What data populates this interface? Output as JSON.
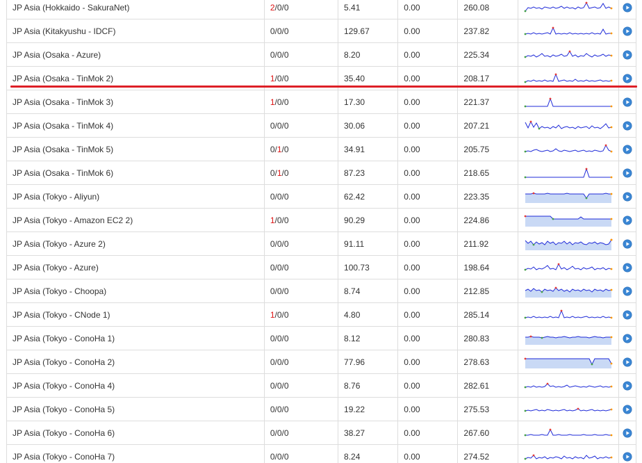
{
  "colors": {
    "loss_highlight": "#dd1111",
    "divider": "#dd1f26",
    "spark_line": "#1f2bd8",
    "spark_fill": "#c9d9f5",
    "play_icon": "#3a86d4"
  },
  "rows": [
    {
      "name": "JP Asia (Hokkaido - SakuraNet)",
      "loss": [
        "2",
        "0",
        "0"
      ],
      "latency": "5.41",
      "jitter": "0.00",
      "max": "260.08",
      "spark": "noisy",
      "sparkline": [
        16,
        11,
        12,
        10,
        12,
        11,
        13,
        10,
        11,
        12,
        10,
        12,
        11,
        9,
        12,
        10,
        12,
        11,
        13,
        10,
        12,
        11,
        4,
        12,
        11,
        10,
        12,
        11,
        5,
        12,
        10,
        12
      ]
    },
    {
      "name": "JP Asia (Kitakyushu - IDCF)",
      "loss": [
        "0",
        "0",
        "0"
      ],
      "latency": "129.67",
      "jitter": "0.00",
      "max": "237.82",
      "spark": "mostly-flat",
      "sparkline": [
        15,
        14,
        15,
        13,
        15,
        14,
        15,
        14,
        13,
        15,
        6,
        15,
        14,
        15,
        14,
        15,
        13,
        15,
        14,
        15,
        14,
        15,
        14,
        15,
        13,
        15,
        14,
        15,
        8,
        15,
        14,
        14
      ]
    },
    {
      "name": "JP Asia (Osaka - Azure)",
      "loss": [
        "0",
        "0",
        "0"
      ],
      "latency": "8.20",
      "jitter": "0.00",
      "max": "225.34",
      "spark": "noisy",
      "sparkline": [
        14,
        12,
        13,
        11,
        14,
        12,
        9,
        13,
        12,
        14,
        11,
        13,
        12,
        10,
        13,
        12,
        6,
        13,
        11,
        14,
        12,
        13,
        9,
        12,
        14,
        11,
        13,
        12,
        10,
        13,
        11,
        12
      ]
    },
    {
      "name": "JP Asia (Osaka - TinMok 2)",
      "loss": [
        "1",
        "0",
        "0"
      ],
      "latency": "35.40",
      "jitter": "0.00",
      "max": "208.17",
      "spark": "spike",
      "sparkline": [
        16,
        14,
        15,
        13,
        15,
        14,
        15,
        13,
        15,
        14,
        15,
        5,
        15,
        14,
        13,
        15,
        14,
        15,
        12,
        15,
        14,
        15,
        13,
        15,
        14,
        15,
        14,
        13,
        15,
        14,
        15,
        14
      ]
    },
    {
      "name": "JP Asia (Osaka - TinMok 3)",
      "loss": [
        "1",
        "0",
        "0"
      ],
      "latency": "17.30",
      "jitter": "0.00",
      "max": "221.37",
      "spark": "single-spike",
      "sparkline": [
        17,
        17,
        17,
        17,
        17,
        17,
        17,
        17,
        17,
        6,
        17,
        17,
        17,
        17,
        17,
        17,
        17,
        17,
        17,
        17,
        17,
        17,
        17,
        17,
        17,
        17,
        17,
        17,
        17,
        17,
        17,
        17
      ]
    },
    {
      "name": "JP Asia (Osaka - TinMok 4)",
      "loss": [
        "0",
        "0",
        "0"
      ],
      "latency": "30.06",
      "jitter": "0.00",
      "max": "207.21",
      "spark": "noisy",
      "sparkline": [
        6,
        14,
        5,
        13,
        7,
        15,
        12,
        14,
        13,
        15,
        12,
        14,
        10,
        15,
        13,
        12,
        14,
        13,
        15,
        12,
        14,
        13,
        12,
        15,
        11,
        14,
        13,
        15,
        12,
        8,
        14,
        13
      ]
    },
    {
      "name": "JP Asia (Osaka - TinMok 5)",
      "loss": [
        "0",
        "1",
        "0"
      ],
      "latency": "34.91",
      "jitter": "0.00",
      "max": "205.75",
      "spark": "low-noise",
      "sparkline": [
        14,
        13,
        14,
        12,
        11,
        13,
        14,
        13,
        12,
        14,
        13,
        10,
        13,
        14,
        12,
        13,
        14,
        13,
        12,
        14,
        13,
        12,
        14,
        13,
        14,
        12,
        13,
        14,
        13,
        5,
        12,
        14
      ]
    },
    {
      "name": "JP Asia (Osaka - TinMok 6)",
      "loss": [
        "0",
        "1",
        "0"
      ],
      "latency": "87.23",
      "jitter": "0.00",
      "max": "218.65",
      "spark": "single-spike",
      "sparkline": [
        17,
        17,
        17,
        17,
        17,
        17,
        17,
        17,
        17,
        17,
        17,
        17,
        17,
        17,
        17,
        17,
        17,
        17,
        17,
        17,
        17,
        17,
        5,
        17,
        17,
        17,
        17,
        17,
        17,
        17,
        17,
        17
      ]
    },
    {
      "name": "JP Asia (Tokyo - Aliyun)",
      "loss": [
        "0",
        "0",
        "0"
      ],
      "latency": "62.42",
      "jitter": "0.00",
      "max": "223.35",
      "spark": "filled-flat",
      "sparkline": [
        7,
        7,
        7,
        6,
        7,
        7,
        7,
        7,
        6,
        7,
        7,
        7,
        7,
        7,
        7,
        6,
        7,
        7,
        7,
        7,
        7,
        7,
        13,
        7,
        7,
        7,
        7,
        7,
        7,
        6,
        7,
        7
      ]
    },
    {
      "name": "JP Asia (Tokyo - Amazon EC2 2)",
      "loss": [
        "1",
        "0",
        "0"
      ],
      "latency": "90.29",
      "jitter": "0.00",
      "max": "224.86",
      "spark": "filled-step",
      "sparkline": [
        5,
        5,
        5,
        5,
        5,
        5,
        5,
        5,
        5,
        5,
        9,
        9,
        9,
        9,
        9,
        9,
        9,
        9,
        9,
        9,
        6,
        9,
        9,
        9,
        9,
        9,
        9,
        9,
        9,
        9,
        9,
        9
      ]
    },
    {
      "name": "JP Asia (Tokyo - Azure 2)",
      "loss": [
        "0",
        "0",
        "0"
      ],
      "latency": "91.11",
      "jitter": "0.00",
      "max": "211.92",
      "spark": "filled-noisy",
      "sparkline": [
        6,
        10,
        7,
        12,
        8,
        11,
        9,
        12,
        7,
        10,
        8,
        12,
        9,
        10,
        7,
        11,
        8,
        12,
        9,
        10,
        8,
        11,
        12,
        9,
        10,
        8,
        11,
        9,
        10,
        12,
        11,
        5
      ]
    },
    {
      "name": "JP Asia (Tokyo - Azure)",
      "loss": [
        "0",
        "0",
        "0"
      ],
      "latency": "100.73",
      "jitter": "0.00",
      "max": "198.64",
      "spark": "noisy",
      "sparkline": [
        14,
        12,
        13,
        10,
        14,
        12,
        13,
        11,
        8,
        13,
        12,
        14,
        6,
        13,
        11,
        14,
        12,
        9,
        13,
        12,
        14,
        11,
        13,
        12,
        10,
        14,
        12,
        13,
        11,
        14,
        12,
        13
      ]
    },
    {
      "name": "JP Asia (Tokyo - Choopa)",
      "loss": [
        "0",
        "0",
        "0"
      ],
      "latency": "8.74",
      "jitter": "0.00",
      "max": "212.85",
      "spark": "filled-noisy",
      "sparkline": [
        10,
        8,
        11,
        7,
        10,
        9,
        12,
        8,
        10,
        9,
        11,
        6,
        10,
        8,
        11,
        9,
        12,
        8,
        10,
        9,
        11,
        8,
        10,
        9,
        12,
        8,
        10,
        9,
        11,
        8,
        10,
        9
      ]
    },
    {
      "name": "JP Asia (Tokyo - CNode 1)",
      "loss": [
        "1",
        "0",
        "0"
      ],
      "latency": "4.80",
      "jitter": "0.00",
      "max": "285.14",
      "spark": "spike",
      "sparkline": [
        15,
        14,
        15,
        13,
        15,
        14,
        15,
        14,
        15,
        13,
        15,
        14,
        15,
        5,
        15,
        14,
        15,
        13,
        15,
        14,
        15,
        14,
        13,
        15,
        14,
        15,
        14,
        15,
        13,
        15,
        14,
        15
      ]
    },
    {
      "name": "JP Asia (Tokyo - ConoHa 1)",
      "loss": [
        "0",
        "0",
        "0"
      ],
      "latency": "8.12",
      "jitter": "0.00",
      "max": "280.83",
      "spark": "filled-flat",
      "sparkline": [
        9,
        9,
        8,
        9,
        9,
        9,
        10,
        9,
        8,
        9,
        9,
        10,
        9,
        9,
        8,
        9,
        10,
        9,
        9,
        8,
        9,
        9,
        9,
        10,
        9,
        8,
        9,
        9,
        10,
        9,
        9,
        9
      ]
    },
    {
      "name": "JP Asia (Tokyo - ConoHa 2)",
      "loss": [
        "0",
        "0",
        "0"
      ],
      "latency": "77.96",
      "jitter": "0.00",
      "max": "278.63",
      "spark": "filled-flat",
      "sparkline": [
        6,
        6,
        6,
        6,
        6,
        6,
        6,
        6,
        6,
        6,
        6,
        6,
        6,
        6,
        6,
        6,
        6,
        6,
        6,
        6,
        6,
        6,
        6,
        6,
        14,
        6,
        6,
        6,
        6,
        6,
        6,
        13
      ]
    },
    {
      "name": "JP Asia (Tokyo - ConoHa 4)",
      "loss": [
        "0",
        "0",
        "0"
      ],
      "latency": "8.76",
      "jitter": "0.00",
      "max": "282.61",
      "spark": "noisy",
      "sparkline": [
        13,
        12,
        13,
        11,
        13,
        12,
        13,
        12,
        8,
        12,
        11,
        13,
        12,
        13,
        12,
        10,
        13,
        12,
        11,
        12,
        13,
        12,
        13,
        11,
        12,
        13,
        12,
        11,
        13,
        12,
        13,
        12
      ]
    },
    {
      "name": "JP Asia (Tokyo - ConoHa 5)",
      "loss": [
        "0",
        "0",
        "0"
      ],
      "latency": "19.22",
      "jitter": "0.00",
      "max": "275.53",
      "spark": "low-noise",
      "sparkline": [
        13,
        12,
        13,
        12,
        11,
        13,
        12,
        13,
        11,
        12,
        13,
        12,
        13,
        12,
        11,
        13,
        12,
        13,
        12,
        10,
        13,
        12,
        13,
        12,
        11,
        13,
        12,
        13,
        12,
        13,
        12,
        11
      ]
    },
    {
      "name": "JP Asia (Tokyo - ConoHa 6)",
      "loss": [
        "0",
        "0",
        "0"
      ],
      "latency": "38.27",
      "jitter": "0.00",
      "max": "267.60",
      "spark": "low-noise",
      "sparkline": [
        14,
        14,
        13,
        14,
        14,
        14,
        13,
        14,
        14,
        6,
        14,
        14,
        13,
        14,
        14,
        14,
        13,
        14,
        14,
        14,
        14,
        13,
        14,
        14,
        14,
        13,
        14,
        14,
        14,
        13,
        14,
        14
      ]
    },
    {
      "name": "JP Asia (Tokyo - ConoHa 7)",
      "loss": [
        "0",
        "0",
        "0"
      ],
      "latency": "8.24",
      "jitter": "0.00",
      "max": "274.52",
      "spark": "noisy",
      "sparkline": [
        14,
        12,
        13,
        9,
        14,
        12,
        13,
        11,
        14,
        12,
        13,
        11,
        12,
        14,
        10,
        13,
        12,
        14,
        11,
        13,
        12,
        14,
        9,
        13,
        12,
        10,
        14,
        12,
        13,
        11,
        13,
        12
      ]
    }
  ]
}
